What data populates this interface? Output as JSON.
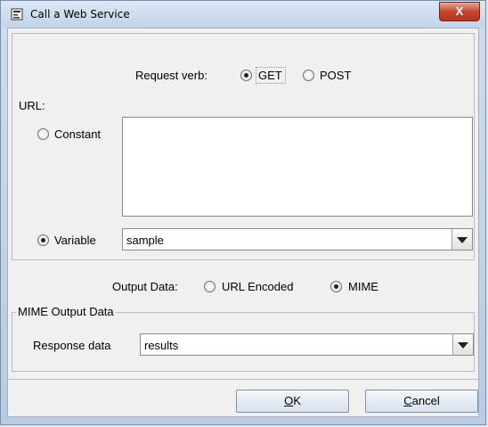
{
  "window": {
    "title": "Call a Web Service",
    "close_label": "X"
  },
  "request": {
    "label": "Request verb:",
    "options": [
      {
        "label": "GET",
        "checked": true
      },
      {
        "label": "POST",
        "checked": false
      }
    ]
  },
  "url": {
    "section_label": "URL:",
    "constant_label": "Constant",
    "constant_value": "",
    "variable_label": "Variable",
    "variable_value": "sample"
  },
  "output": {
    "label": "Output Data:",
    "options": [
      {
        "label": "URL Encoded",
        "checked": false
      },
      {
        "label": "MIME",
        "checked": true
      }
    ]
  },
  "mime": {
    "group_title": "MIME Output Data",
    "response_label": "Response data",
    "response_value": "results"
  },
  "buttons": {
    "ok_mnemonic": "O",
    "ok_rest": "K",
    "cancel_mnemonic": "C",
    "cancel_rest": "ancel"
  }
}
